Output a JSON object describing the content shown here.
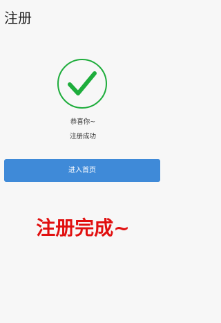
{
  "header": {
    "title": "注册"
  },
  "result": {
    "icon": "check-circle-icon",
    "icon_color": "#1ead3c",
    "congrats_text": "恭喜你~",
    "message": "注册成功"
  },
  "actions": {
    "home_button_label": "进入首页",
    "home_button_color": "#3f8ad8"
  },
  "banner": {
    "caption": "注册完成~",
    "caption_color": "#e11010"
  }
}
